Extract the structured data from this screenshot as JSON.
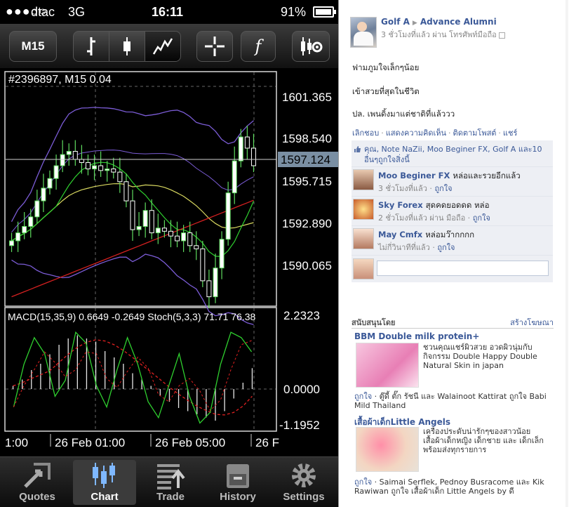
{
  "status_bar": {
    "signal": "●●●○○",
    "carrier": "dtac",
    "network": "3G",
    "time": "16:11",
    "battery": "91%"
  },
  "toolbar": {
    "timeframe_label": "M15",
    "function_label": "f"
  },
  "chart": {
    "symbol_overlay": "#2396897, M15 0.04",
    "current_price_label": "1597.124",
    "price_ticks": [
      "1601.365",
      "1598.540",
      "1595.715",
      "1592.890",
      "1590.065"
    ],
    "indicator_label": "MACD(15,35,9) 0.6649 -0.2649 Stoch(5,3,3) 71.71 76.38",
    "indicator_ticks": [
      "2.2323",
      "0.0000",
      "-1.1952"
    ],
    "time_ticks": [
      "1:00",
      "26 Feb 01:00",
      "26 Feb 05:00",
      "26 F"
    ],
    "colors": {
      "bull_candle": "#ffffff",
      "wick": "#5fdc5f",
      "band": "#7b5cd6",
      "ma_red": "#d42020",
      "ma_yellow": "#d8d860",
      "ma_green": "#2fd02f",
      "macd_signal": "#e02020"
    }
  },
  "chart_data": {
    "type": "line",
    "title": "",
    "xlabel": "",
    "ylabel": "",
    "x": [
      "1:00",
      "26 Feb 01:00",
      "26 Feb 05:00",
      "26 F"
    ],
    "ylim": [
      1588.5,
      1603.0
    ],
    "ohlc_close": [
      1592.5,
      1593.0,
      1593.4,
      1594.0,
      1595.0,
      1595.8,
      1596.4,
      1597.2,
      1597.9,
      1598.1,
      1597.6,
      1597.4,
      1597.0,
      1597.2,
      1596.9,
      1597.0,
      1596.8,
      1596.2,
      1595.0,
      1593.2,
      1593.4,
      1594.4,
      1593.0,
      1593.3,
      1593.1,
      1592.8,
      1592.5,
      1593.0,
      1592.2,
      1592.0,
      1590.0,
      1589.0,
      1590.8,
      1592.6,
      1595.5,
      1597.5,
      1599.0,
      1598.3,
      1597.2
    ],
    "series": [
      {
        "name": "MACD",
        "values": [
          0.1,
          0.3,
          0.6,
          0.8,
          1.1,
          1.4,
          1.6,
          1.7,
          1.6,
          1.5,
          1.2,
          1.0,
          0.8,
          0.5,
          0.3,
          0.1,
          -0.2,
          -0.4,
          -0.6,
          -0.7,
          -0.8,
          -0.9,
          -1.0,
          -0.7,
          -0.3,
          0.2,
          0.66
        ]
      },
      {
        "name": "Stoch",
        "values": [
          20,
          60,
          85,
          70,
          30,
          45,
          90,
          80,
          40,
          20,
          55,
          85,
          60,
          25,
          10,
          40,
          70,
          30,
          5,
          15,
          60,
          90,
          85,
          71.71
        ]
      }
    ]
  },
  "tabbar": {
    "tabs": [
      {
        "label": "Quotes"
      },
      {
        "label": "Chart"
      },
      {
        "label": "Trade"
      },
      {
        "label": "History"
      },
      {
        "label": "Settings"
      }
    ]
  },
  "fb": {
    "author": "Golf A",
    "target": "Advance Alumni",
    "meta": "3 ชั่วโมงที่แล้ว ผ่าน โทรศัพท์มือถือ",
    "text1": "ฟามภูมใจเล็กๆน้อย",
    "text2": "เข้าสวยที่สุดในชีวิต",
    "text3": "ปล. เพนดิ้งมาแต่ชาติที่แล้ววว",
    "actions": [
      "เลิกชอบ",
      "แสดงความคิดเห็น",
      "ติดตามโพสต์",
      "แชร์"
    ],
    "likes_line1": "คุณ, Note NaZii, Moo Beginer FX, Golf A และ10",
    "likes_line2": "อื่นๆถูกใจสิ่งนี้",
    "comments": [
      {
        "name": "Moo Beginer FX",
        "text": "หล่อและรวยอีกแล้ว",
        "time": "3 ชั่วโมงที่แล้ว",
        "like": "ถูกใจ"
      },
      {
        "name": "Sky Forex",
        "text": "สุดคดยอดดด หล่อ",
        "time": "2 ชั่วโมงที่แล้ว ผ่าน มือถือ",
        "like": "ถูกใจ"
      },
      {
        "name": "May Cmfx",
        "text": "หล่อมว๊ากกกก",
        "time": "ไม่กี่วินาทีที่แล้ว",
        "like": "ถูกใจ"
      }
    ],
    "ads_title": "สนับสนุนโดย",
    "ads_create": "สร้างโฆษณา",
    "ads": [
      {
        "title": "BBM Double milk protein+",
        "body": "ชวนคุณแชร์ผิวสวย อวดผิวนุ่มกับกิจกรรม Double Happy Double Natural Skin in japan",
        "like_prefix": "ถูกใจ",
        "like_text": " · ตู๊ดี้ ตั๊ก รัชนี และ Walainoot Kattirat ถูกใจ Babi Mild Thailand"
      },
      {
        "title": "เสื้อผ้าเด็กLittle Angels",
        "body": "เครื่องประดับน่ารักๆของสาวน้อย เสื้อผ้าเด็กหญิง เด็กชาย และ เด็กเล็ก พร้อมส่งทุกรายการ",
        "like_prefix": "ถูกใจ",
        "like_text": " · Saimai Serflek, Pednoy Busracome และ Kik Rawiwan ถูกใจ เสื้อผ้าเด็ก Little Angels by ดี"
      }
    ]
  }
}
